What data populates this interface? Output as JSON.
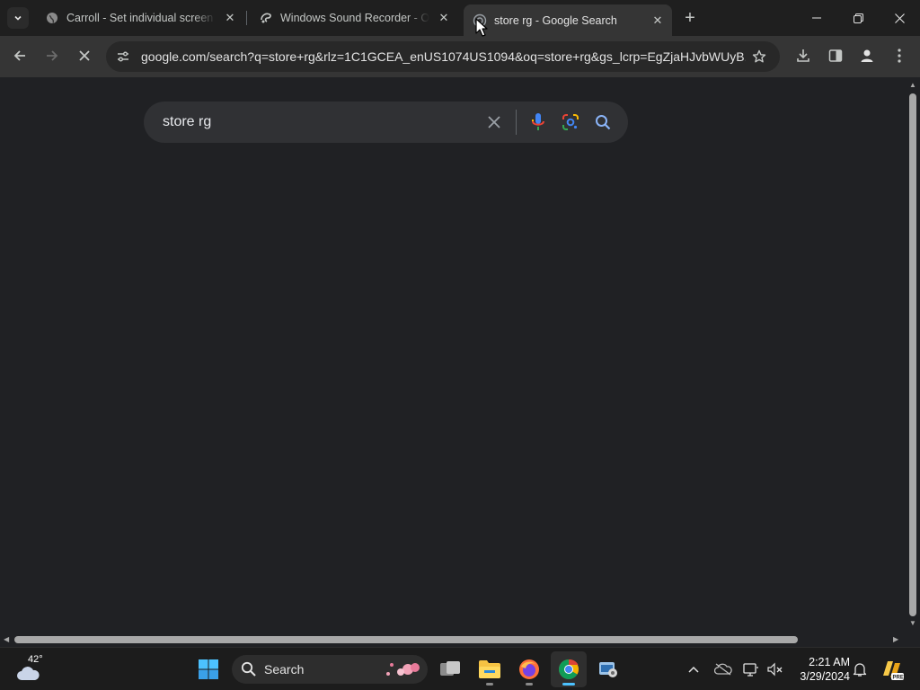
{
  "browser": {
    "tabs": [
      {
        "title": "Carroll - Set individual screen re",
        "active": false
      },
      {
        "title": "Windows Sound Recorder - Offi",
        "active": false
      },
      {
        "title": "store rg - Google Search",
        "active": true
      }
    ],
    "address_bar": {
      "url": "google.com/search?q=store+rg&rlz=1C1GCEA_enUS1074US1094&oq=store+rg&gs_lcrp=EgZjaHJvbWUyB..."
    }
  },
  "page": {
    "search": {
      "query": "store rg"
    }
  },
  "taskbar": {
    "weather_temp": "42°",
    "search_label": "Search",
    "time": "2:21 AM",
    "date": "3/29/2024"
  },
  "colors": {
    "page_background": "#202124",
    "searchbox_background": "#303134",
    "active_tab": "#353535",
    "taskbar_accent": "#4cc2ff"
  },
  "icons": {
    "tab_strip": [
      "tab-search-icon",
      "globe-icon",
      "sound-recorder-icon",
      "google-loading-icon",
      "close-icon",
      "plus-icon"
    ],
    "window": [
      "minimize-icon",
      "restore-icon",
      "close-icon"
    ],
    "toolbar": [
      "back-arrow-icon",
      "forward-arrow-icon",
      "stop-loading-icon",
      "site-info-icon",
      "bookmark-star-icon",
      "download-icon",
      "side-panel-icon",
      "profile-icon",
      "more-menu-icon"
    ],
    "search": [
      "clear-icon",
      "microphone-icon",
      "google-lens-icon",
      "search-magnifier-icon"
    ],
    "taskbar": [
      "weather-cloud-icon",
      "windows-start-icon",
      "search-icon",
      "task-view-icon",
      "file-explorer-icon",
      "firefox-icon",
      "chrome-icon",
      "control-panel-icon",
      "chevron-up-icon",
      "onedrive-icon",
      "display-icon",
      "speaker-muted-icon",
      "bell-icon",
      "copilot-icon"
    ]
  }
}
